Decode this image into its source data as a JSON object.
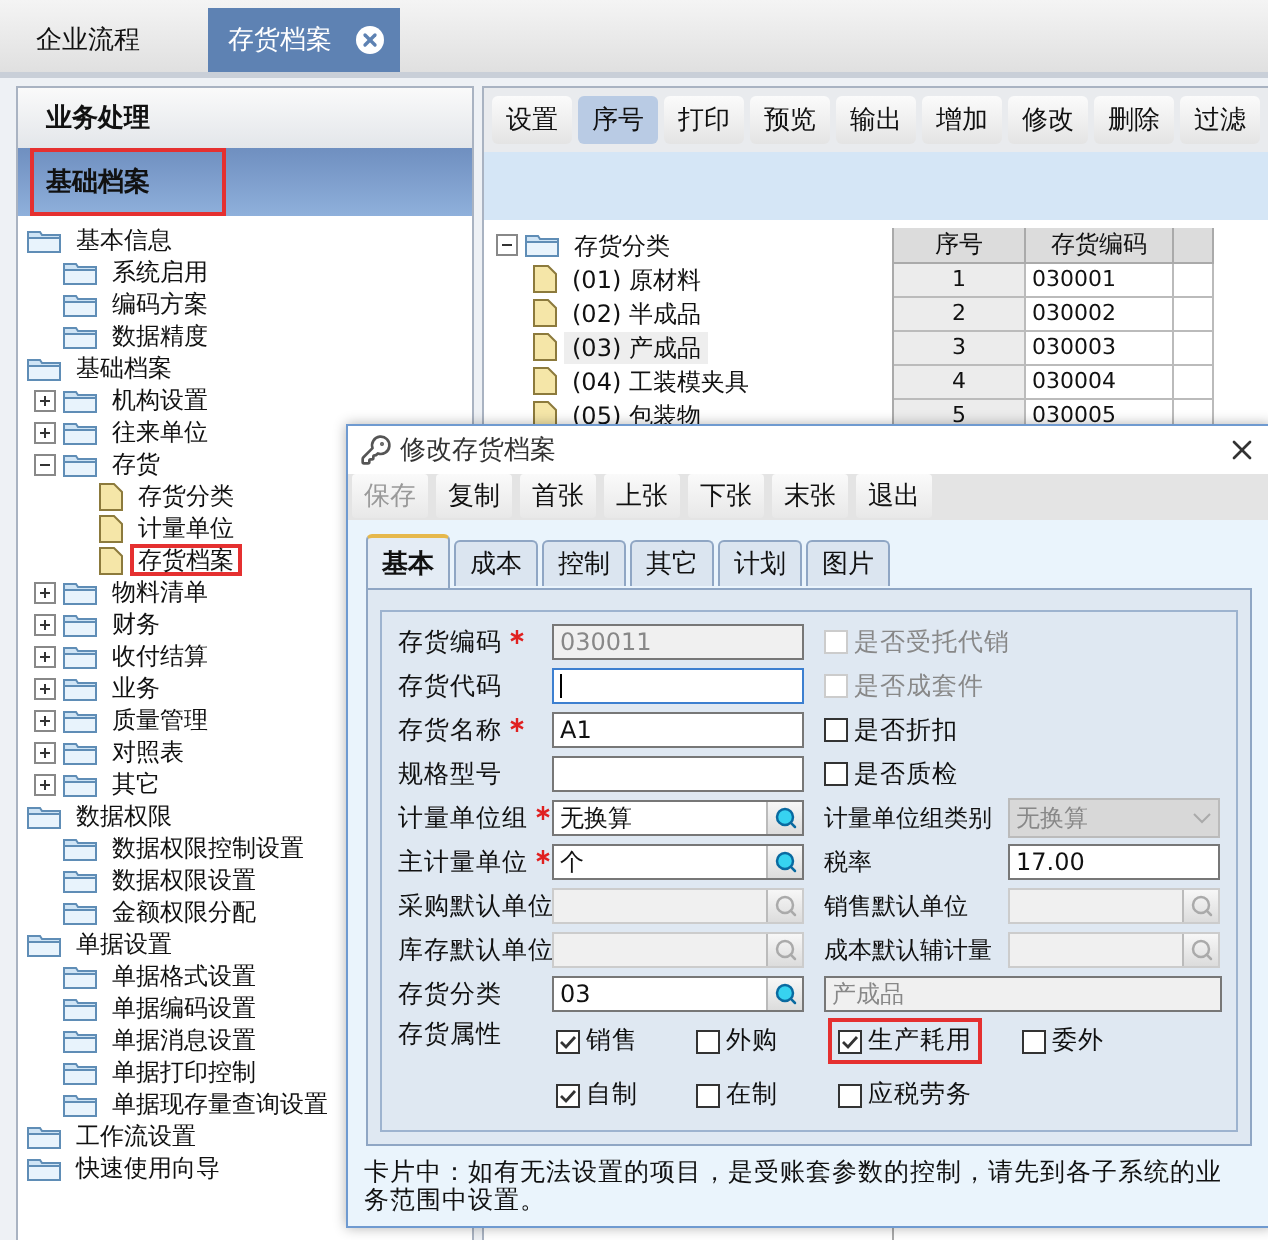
{
  "tabs": [
    {
      "label": "企业流程",
      "selected": false,
      "closable": false
    },
    {
      "label": "存货档案",
      "selected": true,
      "closable": true
    }
  ],
  "sidebar": {
    "sections": [
      {
        "label": "业务处理",
        "selected": false,
        "highlighted": false
      },
      {
        "label": "基础档案",
        "selected": true,
        "highlighted": true
      }
    ],
    "tree": [
      {
        "label": "基本信息",
        "kind": "folder",
        "children": [
          {
            "label": "系统启用",
            "kind": "folder"
          },
          {
            "label": "编码方案",
            "kind": "folder"
          },
          {
            "label": "数据精度",
            "kind": "folder"
          }
        ]
      },
      {
        "label": "基础档案",
        "kind": "folder",
        "children": [
          {
            "label": "机构设置",
            "kind": "folder",
            "expanded": false
          },
          {
            "label": "往来单位",
            "kind": "folder",
            "expanded": false
          },
          {
            "label": "存货",
            "kind": "folder",
            "expanded": true,
            "children": [
              {
                "label": "存货分类",
                "kind": "file"
              },
              {
                "label": "计量单位",
                "kind": "file"
              },
              {
                "label": "存货档案",
                "kind": "file",
                "highlighted": true
              }
            ]
          },
          {
            "label": "物料清单",
            "kind": "folder",
            "expanded": false
          },
          {
            "label": "财务",
            "kind": "folder",
            "expanded": false
          },
          {
            "label": "收付结算",
            "kind": "folder",
            "expanded": false
          },
          {
            "label": "业务",
            "kind": "folder",
            "expanded": false
          },
          {
            "label": "质量管理",
            "kind": "folder",
            "expanded": false
          },
          {
            "label": "对照表",
            "kind": "folder",
            "expanded": false
          },
          {
            "label": "其它",
            "kind": "folder",
            "expanded": false
          }
        ]
      },
      {
        "label": "数据权限",
        "kind": "folder",
        "children": [
          {
            "label": "数据权限控制设置",
            "kind": "folder"
          },
          {
            "label": "数据权限设置",
            "kind": "folder"
          },
          {
            "label": "金额权限分配",
            "kind": "folder"
          }
        ]
      },
      {
        "label": "单据设置",
        "kind": "folder",
        "children": [
          {
            "label": "单据格式设置",
            "kind": "folder"
          },
          {
            "label": "单据编码设置",
            "kind": "folder"
          },
          {
            "label": "单据消息设置",
            "kind": "folder"
          },
          {
            "label": "单据打印控制",
            "kind": "folder"
          },
          {
            "label": "单据现存量查询设置",
            "kind": "folder"
          }
        ]
      },
      {
        "label": "工作流设置",
        "kind": "folder"
      },
      {
        "label": "快速使用向导",
        "kind": "folder"
      }
    ]
  },
  "toolbar": [
    {
      "label": "设置",
      "selected": false
    },
    {
      "label": "序号",
      "selected": true
    },
    {
      "label": "打印",
      "selected": false
    },
    {
      "label": "预览",
      "selected": false
    },
    {
      "label": "输出",
      "selected": false
    },
    {
      "label": "增加",
      "selected": false
    },
    {
      "label": "修改",
      "selected": false
    },
    {
      "label": "删除",
      "selected": false
    },
    {
      "label": "过滤",
      "selected": false
    }
  ],
  "category_tree": {
    "label": "存货分类",
    "expanded": true,
    "children": [
      {
        "label": "(01) 原材料",
        "selected": false
      },
      {
        "label": "(02) 半成品",
        "selected": false
      },
      {
        "label": "(03) 产成品",
        "selected": true
      },
      {
        "label": "(04) 工装模夹具",
        "selected": false
      },
      {
        "label": "(05) 包装物",
        "selected": false
      }
    ]
  },
  "table": {
    "columns": [
      "序号",
      "存货编码"
    ],
    "rows": [
      [
        "1",
        "030001"
      ],
      [
        "2",
        "030002"
      ],
      [
        "3",
        "030003"
      ],
      [
        "4",
        "030004"
      ],
      [
        "5",
        "030005"
      ]
    ]
  },
  "dialog": {
    "title": "修改存货档案",
    "buttons": [
      {
        "label": "保存",
        "disabled": true
      },
      {
        "label": "复制",
        "disabled": false
      },
      {
        "label": "首张",
        "disabled": false
      },
      {
        "label": "上张",
        "disabled": false
      },
      {
        "label": "下张",
        "disabled": false
      },
      {
        "label": "末张",
        "disabled": false
      },
      {
        "label": "退出",
        "disabled": false
      }
    ],
    "tabs": [
      {
        "label": "基本",
        "selected": true
      },
      {
        "label": "成本",
        "selected": false
      },
      {
        "label": "控制",
        "selected": false
      },
      {
        "label": "其它",
        "selected": false
      },
      {
        "label": "计划",
        "selected": false
      },
      {
        "label": "图片",
        "selected": false
      }
    ],
    "left_fields": [
      {
        "label": "存货编码",
        "required": true,
        "kind": "text",
        "value": "030011",
        "disabled": true,
        "focused": false
      },
      {
        "label": "存货代码",
        "required": false,
        "kind": "text",
        "disabled": false,
        "focused": true
      },
      {
        "label": "存货名称",
        "required": true,
        "kind": "text",
        "value": "A1",
        "disabled": false,
        "focused": false
      },
      {
        "label": "规格型号",
        "required": false,
        "kind": "text",
        "disabled": false,
        "focused": false
      },
      {
        "label": "计量单位组",
        "required": true,
        "kind": "lookup",
        "value": "无换算",
        "disabled": false
      },
      {
        "label": "主计量单位",
        "required": true,
        "kind": "lookup",
        "value": "个",
        "disabled": false
      },
      {
        "label": "采购默认单位",
        "required": false,
        "kind": "lookup",
        "disabled": true
      },
      {
        "label": "库存默认单位",
        "required": false,
        "kind": "lookup",
        "disabled": true
      },
      {
        "label": "存货分类",
        "required": false,
        "kind": "lookup",
        "value": "03",
        "disabled": false
      }
    ],
    "right_fields": [
      {
        "kind": "checkbox",
        "label": "是否受托代销",
        "checked": false,
        "disabled": true
      },
      {
        "kind": "checkbox",
        "label": "是否成套件",
        "checked": false,
        "disabled": true
      },
      {
        "kind": "checkbox",
        "label": "是否折扣",
        "checked": false,
        "disabled": false
      },
      {
        "kind": "checkbox",
        "label": "是否质检",
        "checked": false,
        "disabled": false
      },
      {
        "kind": "select",
        "label": "计量单位组类别",
        "value": "无换算",
        "disabled": true
      },
      {
        "kind": "text",
        "label": "税率",
        "value": "17.00",
        "disabled": false
      },
      {
        "kind": "lookup",
        "label": "销售默认单位",
        "disabled": true
      },
      {
        "kind": "lookup",
        "label": "成本默认辅计量",
        "disabled": true
      },
      {
        "kind": "display",
        "value": "产成品",
        "disabled": true
      }
    ],
    "attributes": {
      "label": "存货属性",
      "options": [
        {
          "label": "销售",
          "checked": true,
          "highlighted": false
        },
        {
          "label": "外购",
          "checked": false,
          "highlighted": false
        },
        {
          "label": "生产耗用",
          "checked": true,
          "highlighted": true
        },
        {
          "label": "委外",
          "checked": false,
          "highlighted": false
        },
        {
          "label": "自制",
          "checked": true,
          "highlighted": false
        },
        {
          "label": "在制",
          "checked": false,
          "highlighted": false
        },
        {
          "label": "应税劳务",
          "checked": false,
          "highlighted": false
        }
      ]
    },
    "note": "卡片中：如有无法设置的项目，是受账套参数的控制，请先到各子系统的业务范围中设置。"
  }
}
